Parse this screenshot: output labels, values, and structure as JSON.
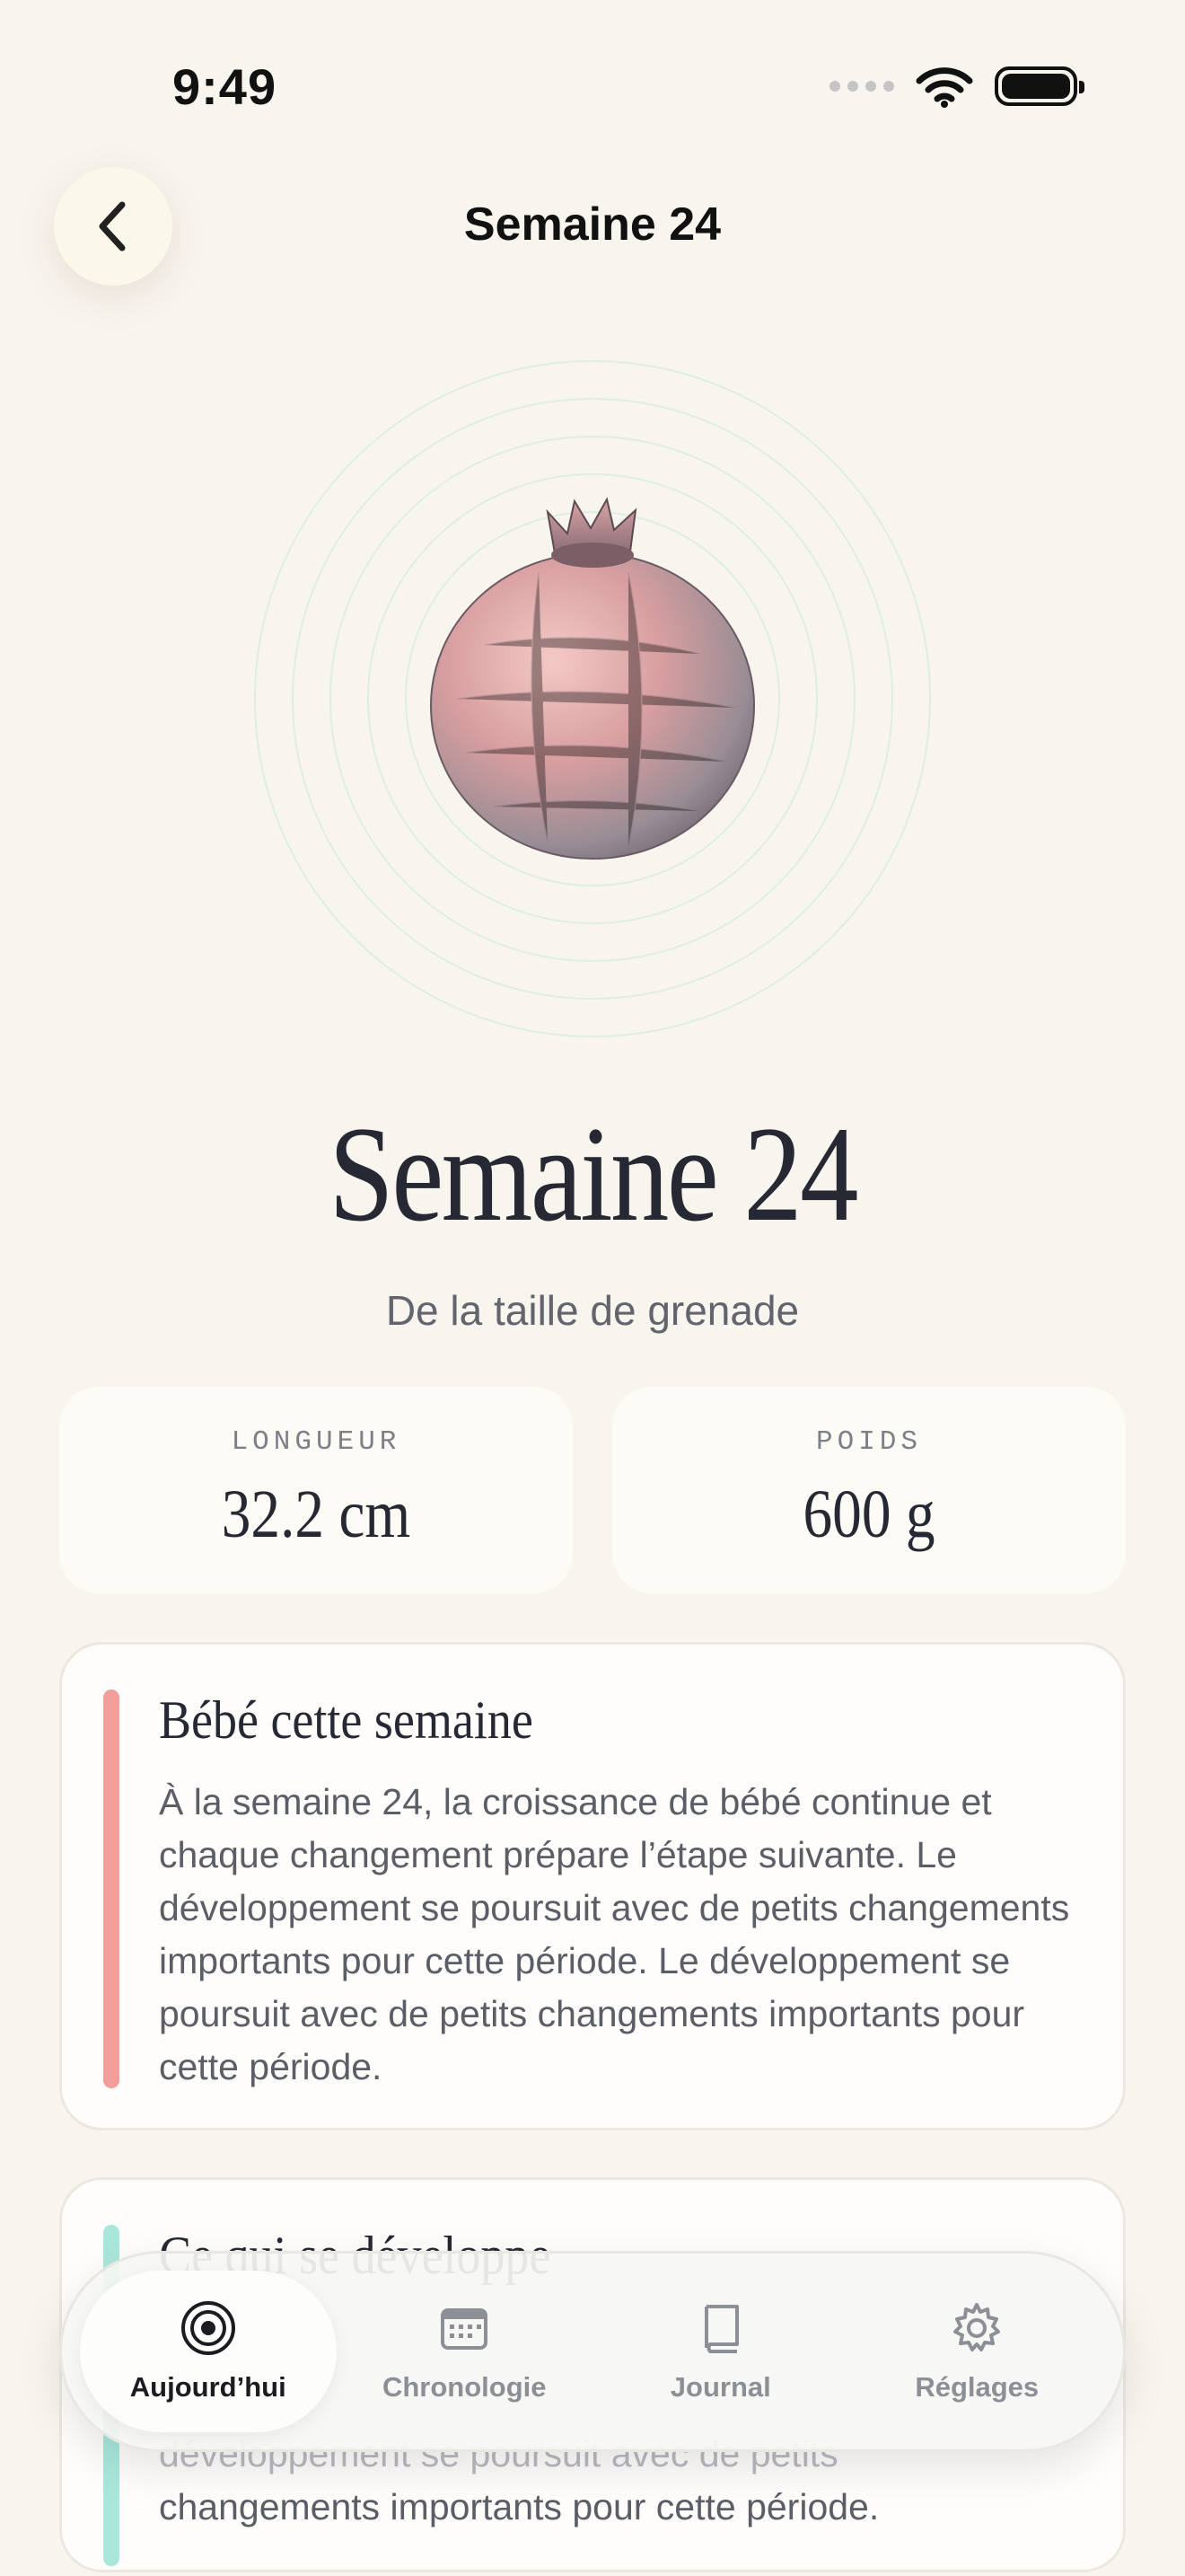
{
  "status": {
    "time": "9:49"
  },
  "nav": {
    "title": "Semaine 24"
  },
  "hero": {
    "icon": "pomegranate-illustration"
  },
  "week": {
    "title": "Semaine 24",
    "subtitle": "De la taille de grenade"
  },
  "stats": [
    {
      "label": "LONGUEUR",
      "value": "32.2 cm"
    },
    {
      "label": "POIDS",
      "value": "600 g"
    }
  ],
  "cards": {
    "baby": {
      "title": "Bébé cette semaine",
      "body": "À la semaine 24, la croissance de bébé continue et chaque changement prépare l’étape suivante. Le développement se poursuit avec de petits changements importants pour cette période. Le développement se poursuit avec de petits changements importants pour cette période.",
      "accent": "#f29f9b"
    },
    "develop": {
      "title": "Ce qui se développe",
      "body_line_faded": "développement se poursuit avec de petits",
      "body_line": "changements importants pour cette période.",
      "accent": "#a9e7da"
    }
  },
  "tabs": [
    {
      "label": "Aujourd’hui",
      "icon": "target-icon",
      "active": true
    },
    {
      "label": "Chronologie",
      "icon": "calendar-icon",
      "active": false
    },
    {
      "label": "Journal",
      "icon": "book-icon",
      "active": false
    },
    {
      "label": "Réglages",
      "icon": "gear-icon",
      "active": false
    }
  ],
  "colors": {
    "background": "#f8f4ee",
    "text": "#262833",
    "muted": "#8c8f96"
  }
}
